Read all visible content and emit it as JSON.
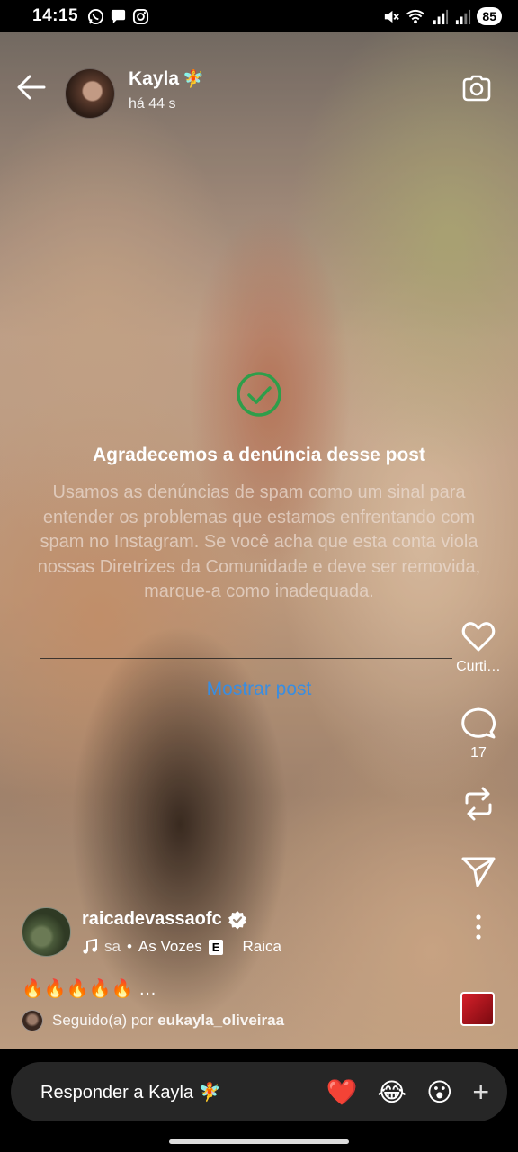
{
  "status_bar": {
    "time": "14:15",
    "battery": "85",
    "left_icons": [
      "whatsapp-icon",
      "chat-icon",
      "instagram-icon"
    ],
    "right_icons": [
      "mute-icon",
      "wifi-icon",
      "signal-icon",
      "signal-icon"
    ]
  },
  "header": {
    "username": "Kayla",
    "name_emoji": "🧚",
    "time_ago": "há 44 s"
  },
  "report": {
    "title": "Agradecemos a denúncia desse post",
    "body": "Usamos as denúncias de spam como um sinal para entender os problemas que estamos enfrentando com spam no Instagram. Se você acha que esta conta viola nossas Diretrizes da Comunidade e deve ser removida, marque-a como inadequada.",
    "show_post": "Mostrar post",
    "check_color": "#2e9e4a"
  },
  "actions": {
    "like_label": "Curti…",
    "comments_count": "17"
  },
  "author": {
    "name": "raicadevassaofc",
    "music_fragment": "sa",
    "music_artist": "As Vozes",
    "explicit": "E",
    "music_extra": "Raica",
    "caption": "🔥🔥🔥🔥🔥 …",
    "followed_prefix": "Seguido(a) por",
    "followed_by": "eukayla_oliveiraa"
  },
  "reply": {
    "placeholder": "Responder a Kayla 🧚",
    "quick_reactions": [
      "❤️",
      "😂",
      "😮"
    ],
    "plus": "+"
  },
  "colors": {
    "link_blue": "#3a8de0",
    "reply_bg": "#262626"
  }
}
